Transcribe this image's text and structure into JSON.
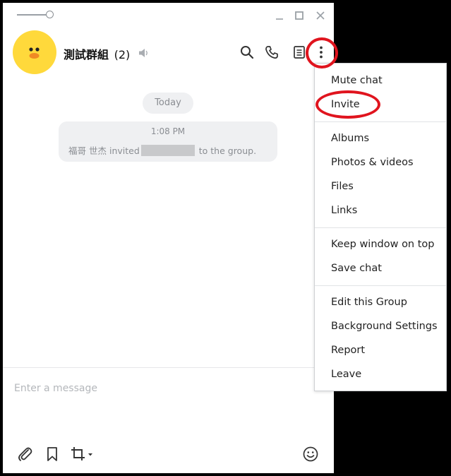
{
  "chat": {
    "group_name": "測試群組",
    "member_count": "(2)",
    "date_label": "Today",
    "system_message": {
      "time": "1:08 PM",
      "actor": "福哥 世杰",
      "action": "invited",
      "suffix": "to the group."
    }
  },
  "composer": {
    "placeholder": "Enter a message"
  },
  "menu": {
    "mute": "Mute chat",
    "invite": "Invite",
    "albums": "Albums",
    "photos_videos": "Photos & videos",
    "files": "Files",
    "links": "Links",
    "keep_on_top": "Keep window on top",
    "save_chat": "Save chat",
    "edit_group": "Edit this Group",
    "background": "Background Settings",
    "report": "Report",
    "leave": "Leave"
  },
  "colors": {
    "avatar_bg": "#ffd93b",
    "highlight": "#e0141e",
    "bubble_bg": "#eff0f2"
  }
}
